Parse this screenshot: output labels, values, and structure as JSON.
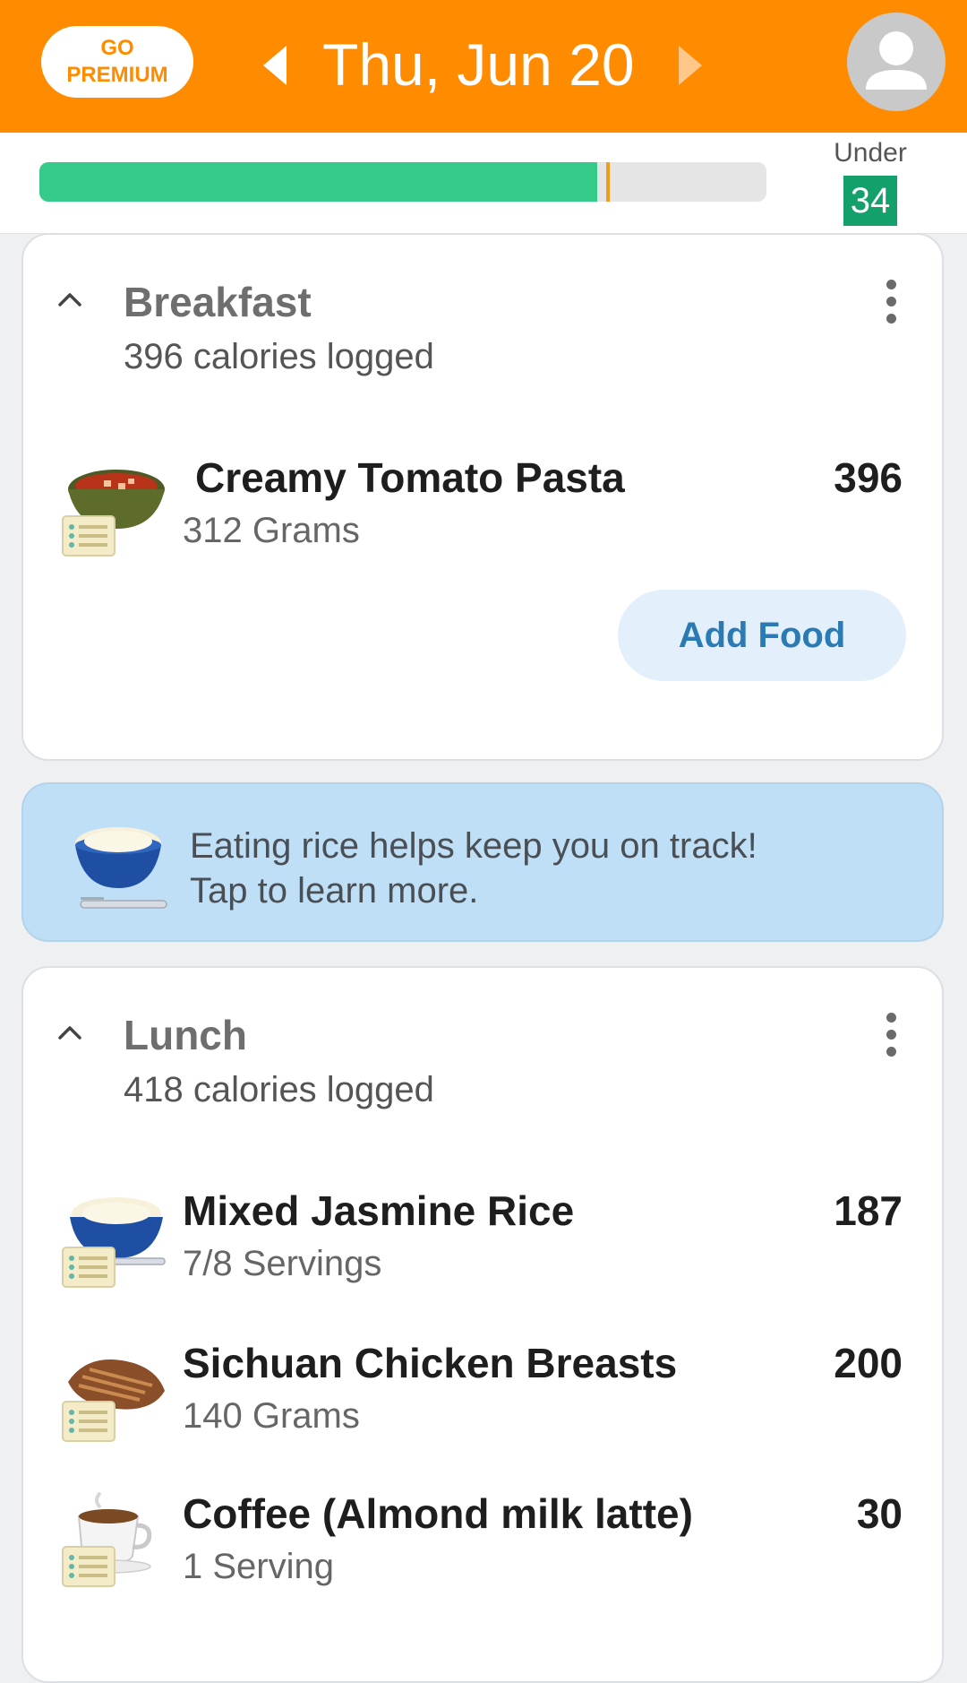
{
  "header": {
    "premium_label_line1": "GO",
    "premium_label_line2": "PREMIUM",
    "date": "Thu, Jun 20",
    "background": "#ff8c00"
  },
  "budget": {
    "status_label": "Under",
    "remaining": "34",
    "progress_fraction": 0.767,
    "bar_color": "#35c98a",
    "badge_color": "#14a06a"
  },
  "breakfast": {
    "title": "Breakfast",
    "subtitle": "396 calories logged",
    "items": [
      {
        "name": "Creamy Tomato Pasta",
        "amount": "312 Grams",
        "calories": "396",
        "icon": "tomato-soup-icon"
      }
    ],
    "add_food_label": "Add Food"
  },
  "tip": {
    "line1": "Eating rice helps keep you on track!",
    "line2": "Tap to learn more.",
    "icon": "rice-bowl-icon"
  },
  "lunch": {
    "title": "Lunch",
    "subtitle": "418 calories logged",
    "items": [
      {
        "name": "Mixed Jasmine Rice",
        "amount": "7/8 Servings",
        "calories": "187",
        "icon": "rice-bowl-icon"
      },
      {
        "name": "Sichuan Chicken Breasts",
        "amount": "140 Grams",
        "calories": "200",
        "icon": "chicken-breast-icon"
      },
      {
        "name": "Coffee (Almond milk latte)",
        "amount": "1 Serving",
        "calories": "30",
        "icon": "coffee-cup-icon"
      }
    ]
  }
}
